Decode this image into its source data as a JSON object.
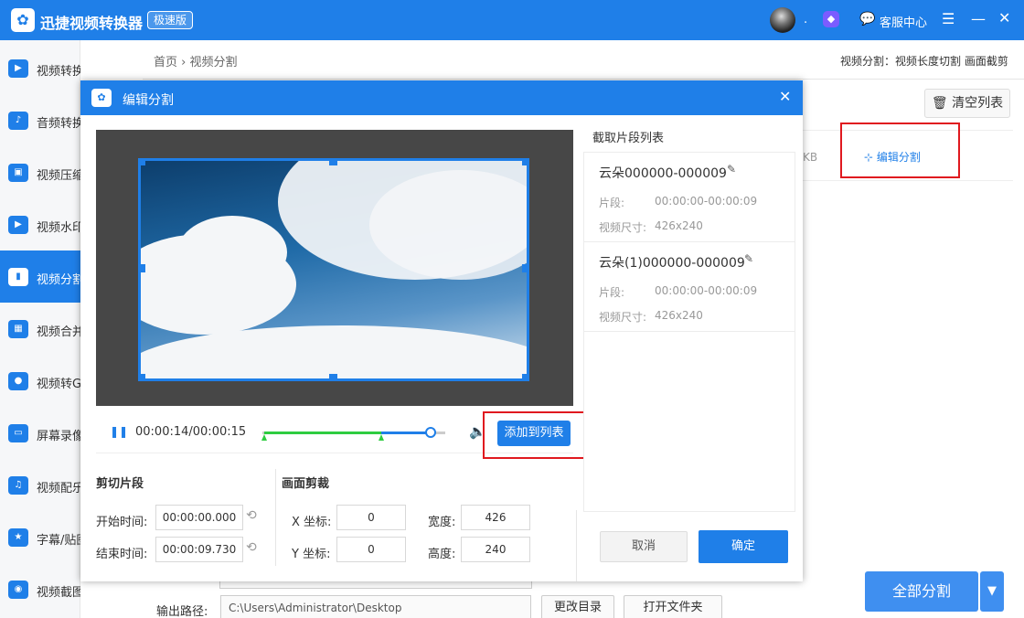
{
  "app": {
    "title": "迅捷视频转换器",
    "badge": "极速版",
    "dot": ".",
    "service_label": "客服中心"
  },
  "sidebar": {
    "items": [
      {
        "label": "视频转换",
        "active": false
      },
      {
        "label": "音频转换",
        "active": false
      },
      {
        "label": "视频压缩",
        "active": false
      },
      {
        "label": "视频水印",
        "active": false
      },
      {
        "label": "视频分割",
        "active": true
      },
      {
        "label": "视频合并",
        "active": false
      },
      {
        "label": "视频转GIF",
        "active": false
      },
      {
        "label": "屏幕录像",
        "active": false
      },
      {
        "label": "视频配乐",
        "active": false
      },
      {
        "label": "字幕/贴图",
        "active": false
      },
      {
        "label": "视频截图",
        "active": false
      }
    ]
  },
  "main": {
    "breadcrumb": "首页 › 视频分割",
    "mode_info": "视频分割：视频长度切割 画面截剪",
    "clear_list": "清空列表",
    "file_size_suffix": "KB",
    "edit_split": "编辑分割",
    "output_label": "输出路径:",
    "output_path": "C:\\Users\\Administrator\\Desktop",
    "change_dir": "更改目录",
    "open_folder": "打开文件夹",
    "split_all": "全部分割"
  },
  "dialog": {
    "title": "编辑分割",
    "player": {
      "time": "00:00:14/00:00:15",
      "progress": 0.9,
      "segment_start": 0.0,
      "segment_end": 0.64
    },
    "add_to_list": "添加到列表",
    "segment": {
      "title": "剪切片段",
      "start_label": "开始时间:",
      "start_value": "00:00:00.000",
      "end_label": "结束时间:",
      "end_value": "00:00:09.730"
    },
    "crop": {
      "title": "画面剪裁",
      "x_label": "X 坐标:",
      "x_value": "0",
      "y_label": "Y 坐标:",
      "y_value": "0",
      "width_label": "宽度:",
      "width_value": "426",
      "height_label": "高度:",
      "height_value": "240"
    },
    "list_title": "截取片段列表",
    "clips": [
      {
        "name": "云朵000000-000009",
        "seg_label": "片段:",
        "seg_value": "00:00:00-00:00:09",
        "size_label": "视频尺寸:",
        "size_value": "426x240"
      },
      {
        "name": "云朵(1)000000-000009",
        "seg_label": "片段:",
        "seg_value": "00:00:00-00:00:09",
        "size_label": "视频尺寸:",
        "size_value": "426x240"
      }
    ],
    "cancel": "取消",
    "ok": "确定"
  },
  "colors": {
    "accent": "#1f7fe8",
    "highlight": "#e0191f",
    "track_green": "#2ecc40"
  }
}
